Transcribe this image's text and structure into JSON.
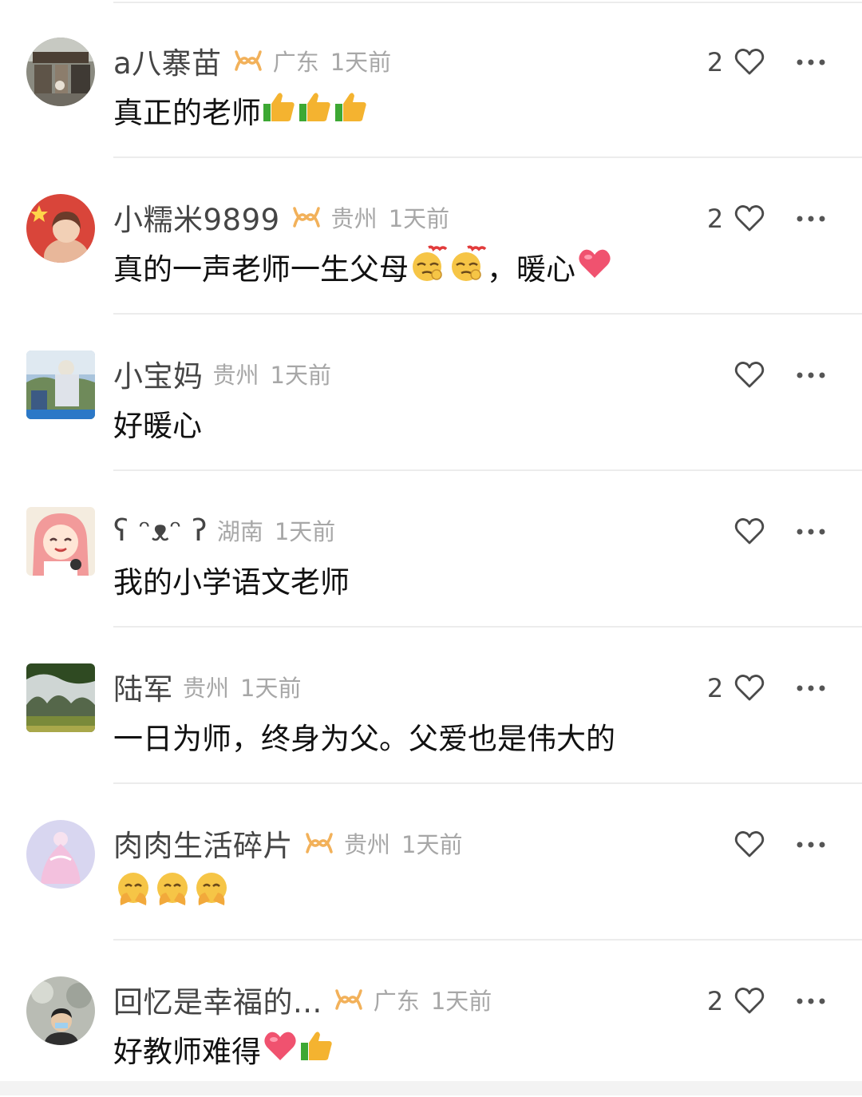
{
  "comments": [
    {
      "username": "a八寨苗",
      "has_badge": true,
      "location": "广东",
      "time": "1天前",
      "likes": "2",
      "text": "真正的老师",
      "emojis": [
        "thumbs-up",
        "thumbs-up",
        "thumbs-up"
      ]
    },
    {
      "username": "小糯米9899",
      "has_badge": true,
      "location": "贵州",
      "time": "1天前",
      "likes": "2",
      "text": "真的一声老师一生父母",
      "emojis": [
        "666-face",
        "666-face"
      ],
      "text_after": "，暖心",
      "emojis_after": [
        "heart"
      ]
    },
    {
      "username": "小宝妈",
      "has_badge": false,
      "location": "贵州",
      "time": "1天前",
      "likes": "",
      "text": "好暖心"
    },
    {
      "username": "ʕ ᵔᴥᵔ ʔ",
      "has_badge": false,
      "location": "湖南",
      "time": "1天前",
      "likes": "",
      "text": "我的小学语文老师"
    },
    {
      "username": "陆军",
      "has_badge": false,
      "location": "贵州",
      "time": "1天前",
      "likes": "2",
      "text": "一日为师，终身为父。父爱也是伟大的"
    },
    {
      "username": "肉肉生活碎片",
      "has_badge": true,
      "location": "贵州",
      "time": "1天前",
      "likes": "",
      "text": "",
      "emojis": [
        "pray-face",
        "pray-face",
        "pray-face"
      ]
    },
    {
      "username": "回忆是幸福的...",
      "has_badge": true,
      "location": "广东",
      "time": "1天前",
      "likes": "2",
      "text": "好教师难得",
      "emojis": [
        "heart",
        "thumbs-up"
      ]
    }
  ],
  "colors": {
    "badge": "#f2b15a",
    "meta": "#a7a7a7",
    "divider": "#ececec"
  }
}
